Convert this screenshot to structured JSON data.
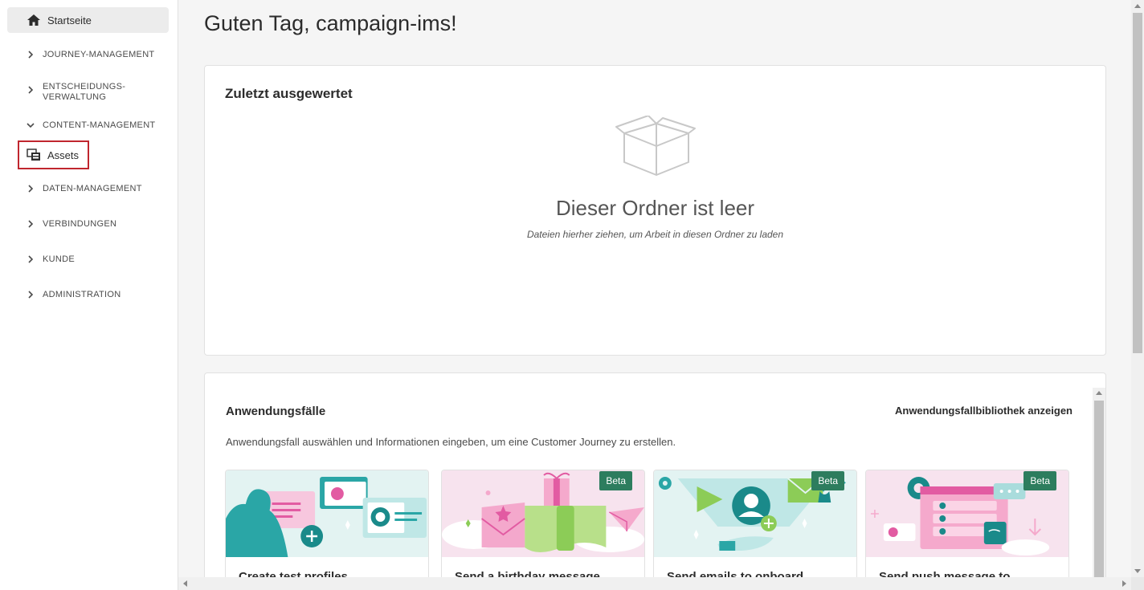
{
  "sidebar": {
    "home_label": "Startseite",
    "sections": [
      {
        "label": "JOURNEY-MANAGEMENT",
        "expanded": false
      },
      {
        "label": "ENTSCHEIDUNGS-",
        "label2": "VERWALTUNG",
        "expanded": false
      },
      {
        "label": "CONTENT-MANAGEMENT",
        "expanded": true
      },
      {
        "label": "DATEN-MANAGEMENT",
        "expanded": false
      },
      {
        "label": "VERBINDUNGEN",
        "expanded": false
      },
      {
        "label": "KUNDE",
        "expanded": false
      },
      {
        "label": "ADMINISTRATION",
        "expanded": false
      }
    ],
    "assets_label": "Assets"
  },
  "main": {
    "greeting": "Guten Tag, campaign-ims!",
    "recent": {
      "title": "Zuletzt ausgewertet",
      "empty_title": "Dieser Ordner ist leer",
      "empty_subtitle": "Dateien hierher ziehen, um Arbeit in diesen Ordner zu laden"
    },
    "use_cases": {
      "title": "Anwendungsfälle",
      "library_link": "Anwendungsfallbibliothek anzeigen",
      "description": "Anwendungsfall auswählen und Informationen eingeben, um eine Customer Journey zu erstellen.",
      "cards": [
        {
          "title": "Create test profiles",
          "beta": ""
        },
        {
          "title": "Send a birthday message",
          "beta": "Beta"
        },
        {
          "title": "Send emails to onboard",
          "beta": "Beta"
        },
        {
          "title": "Send push message to",
          "beta": "Beta"
        }
      ]
    }
  },
  "colors": {
    "accent_green": "#2d7d5e",
    "highlight_red": "#c0262e",
    "teal": "#2aa6a6",
    "pink": "#e25ba2"
  }
}
